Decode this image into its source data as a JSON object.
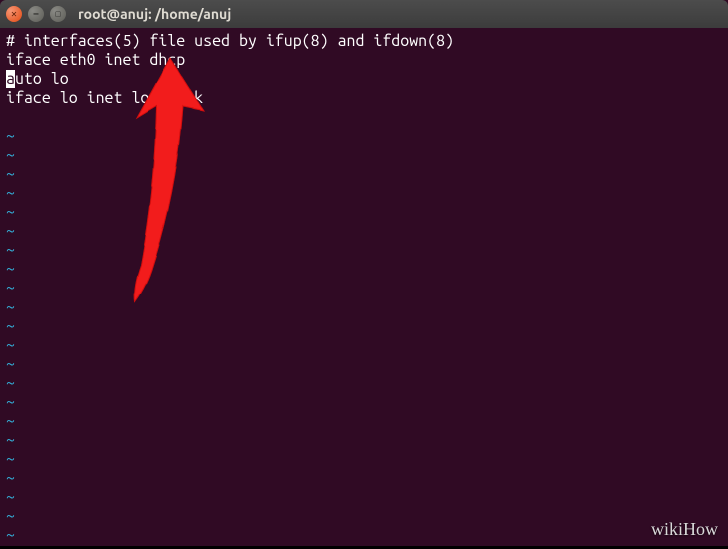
{
  "titlebar": {
    "title": "root@anuj: /home/anuj"
  },
  "terminal": {
    "line1": "# interfaces(5) file used by ifup(8) and ifdown(8)",
    "line2": "iface eth0 inet dhcp",
    "line3_cursor": "a",
    "line3_rest": "uto lo",
    "line4": "iface lo inet loopback",
    "tilde": "~"
  },
  "watermark": {
    "text": "wikiHow"
  }
}
